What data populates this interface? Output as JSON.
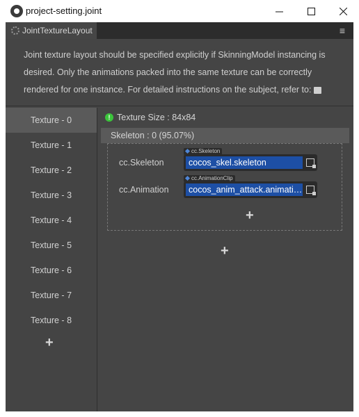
{
  "window": {
    "title": "project-setting.joint",
    "app_icon": "cocos-creator-icon",
    "controls": [
      "minimize-icon",
      "maximize-icon",
      "close-icon"
    ]
  },
  "panel": {
    "tab_label": "JointTextureLayout",
    "tab_icon": "gear-icon",
    "menu_icon": "hamburger-menu-icon",
    "description": "Joint texture layout should be specified explicitly if SkinningModel instancing is desired. Only the animations packed into the same texture can be correctly rendered for one instance. For detailed instructions on the subject, refer to:",
    "doc_icon": "book-icon"
  },
  "textures": [
    {
      "label": "Texture - 0",
      "active": true
    },
    {
      "label": "Texture - 1",
      "active": false
    },
    {
      "label": "Texture - 2",
      "active": false
    },
    {
      "label": "Texture - 3",
      "active": false
    },
    {
      "label": "Texture - 4",
      "active": false
    },
    {
      "label": "Texture - 5",
      "active": false
    },
    {
      "label": "Texture - 6",
      "active": false
    },
    {
      "label": "Texture - 7",
      "active": false
    },
    {
      "label": "Texture - 8",
      "active": false
    }
  ],
  "add_symbol": "+",
  "detail": {
    "status_icon": "exclamation-circle-icon",
    "status_color": "#3bc43b",
    "texture_size": "Texture Size : 84x84",
    "skeleton_header": "Skeleton : 0 (95.07%)",
    "skeleton_prop": {
      "label": "cc.Skeleton",
      "type_tag": "cc.Skeleton",
      "value": "cocos_skel.skeleton"
    },
    "animation_prop": {
      "label": "cc.Animation",
      "type_tag": "cc.AnimationClip",
      "value": "cocos_anim_attack.animati…"
    }
  },
  "colors": {
    "panel_bg": "#454545",
    "asset_field": "#1d4fa5",
    "active_item": "#5a5a5a"
  }
}
